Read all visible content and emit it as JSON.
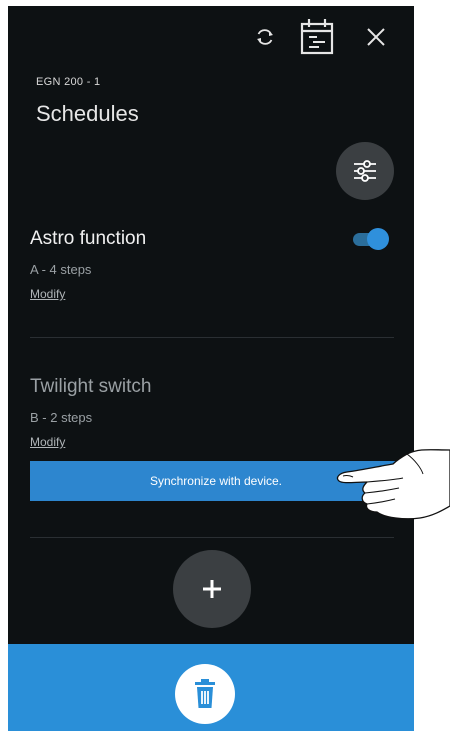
{
  "header": {
    "icons": [
      "refresh-icon",
      "calendar-icon",
      "close-icon"
    ],
    "device_label": "EGN 200 - 1",
    "title": "Schedules"
  },
  "schedules": [
    {
      "name": "Astro function",
      "steps": "A - 4 steps",
      "modify_label": "Modify",
      "enabled": true
    },
    {
      "name": "Twilight switch",
      "steps": "B - 2 steps",
      "modify_label": "Modify"
    }
  ],
  "sync": {
    "label": "Synchronize with device."
  },
  "colors": {
    "background": "#0d1113",
    "accent": "#2a8fd8",
    "fab": "#3b3f42"
  }
}
